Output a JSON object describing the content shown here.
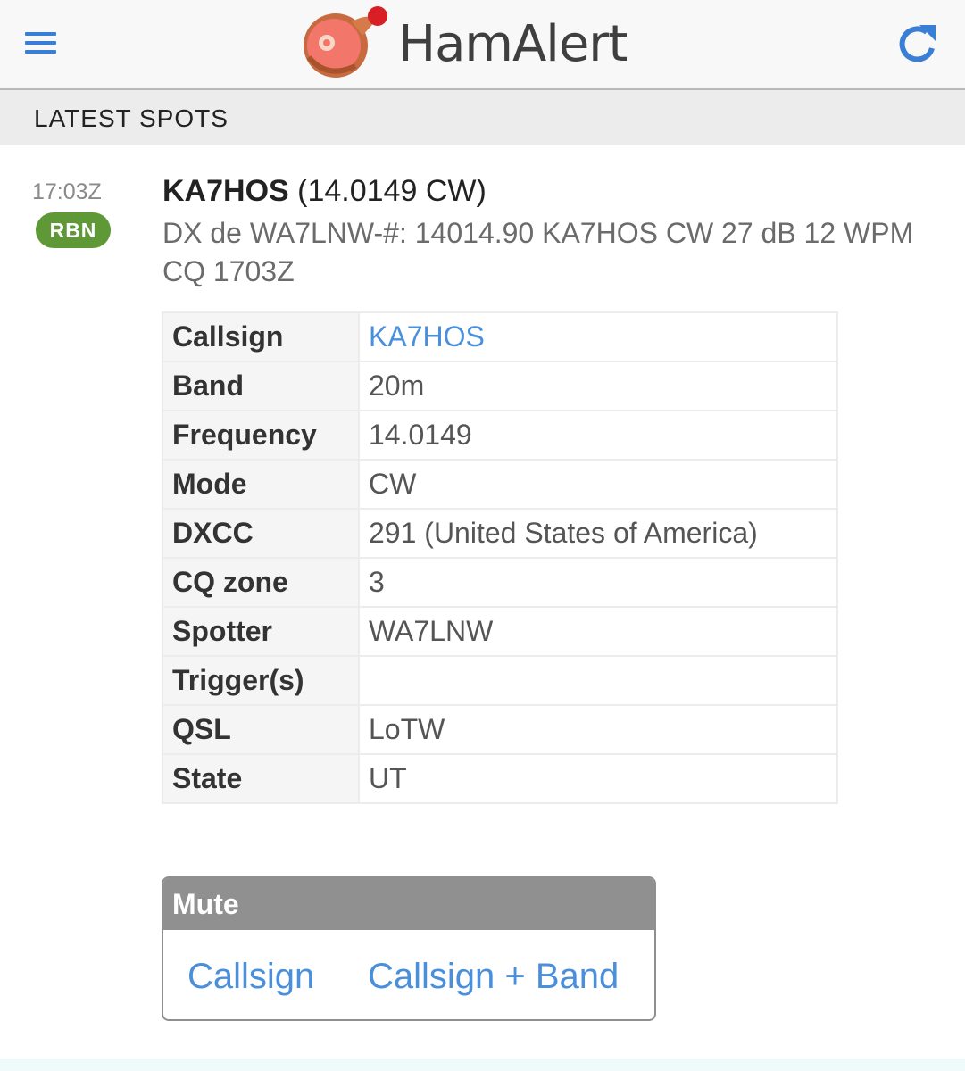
{
  "app": {
    "title": "HamAlert",
    "menu_icon": "hamburger-menu-icon",
    "refresh_icon": "refresh-icon",
    "accent_color": "#3a7fd6"
  },
  "section": {
    "title": "LATEST SPOTS"
  },
  "spot": {
    "time": "17:03Z",
    "source_badge": "RBN",
    "badge_color": "#5f9937",
    "callsign": "KA7HOS",
    "freq_mode": "(14.0149 CW)",
    "raw": "DX de WA7LNW-#: 14014.90 KA7HOS CW 27 dB 12 WPM CQ 1703Z",
    "details": [
      {
        "label": "Callsign",
        "value": "KA7HOS"
      },
      {
        "label": "Band",
        "value": "20m"
      },
      {
        "label": "Frequency",
        "value": "14.0149"
      },
      {
        "label": "Mode",
        "value": "CW"
      },
      {
        "label": "DXCC",
        "value": "291 (United States of America)"
      },
      {
        "label": "CQ zone",
        "value": "3"
      },
      {
        "label": "Spotter",
        "value": "WA7LNW"
      },
      {
        "label": "Trigger(s)",
        "value": ""
      },
      {
        "label": "QSL",
        "value": "LoTW"
      },
      {
        "label": "State",
        "value": "UT"
      }
    ]
  },
  "mute": {
    "title": "Mute",
    "callsign_label": "Callsign",
    "callsign_band_label": "Callsign + Band"
  }
}
